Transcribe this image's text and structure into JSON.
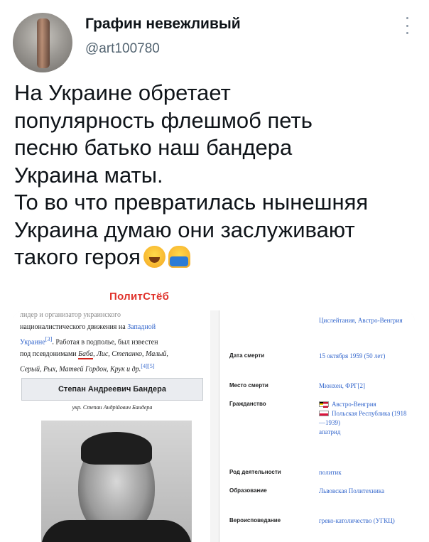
{
  "header": {
    "display_name": "Графин невежливый",
    "handle": "@art100780"
  },
  "tweet": {
    "lines": [
      "На Украине обретает",
      "популярность флешмоб петь",
      "песню батько наш бандера",
      "Украина маты.",
      "То во что превратилась нынешняя",
      "Украина думаю они заслуживают",
      "такого героя"
    ],
    "emojis": [
      "face-with-tears-of-joy",
      "person-facepalming"
    ]
  },
  "watermark": "ПолитСтёб",
  "wiki_left": {
    "line1": "лидер и организатор украинского",
    "line2a": "националистического движения на ",
    "line2b": "Западной",
    "line3a": "Украине",
    "line3ref": "[3]",
    "line3b": ". Работая в подполье, был известен",
    "line4a": "под псевдонимами ",
    "line4b": "Баба",
    "line4c": ", Лис, Степанко, Малый,",
    "line5a": "Серый, Рых, Матвей ",
    "line5b": "Гордон",
    "line5c": ", Крук и др.",
    "line5ref": "[4][5]",
    "infobox_title": "Степан Андреевич Бандера",
    "infobox_native": "укр. Степан Андрійович Бандера"
  },
  "wiki_right": {
    "top_value": "Цислейтания, Австро-Венгрия",
    "rows": [
      {
        "key": "Дата смерти",
        "value": "15 октября 1959 (50 лет)"
      },
      {
        "key": "Место смерти",
        "value": "Мюнхен, ФРГ[2]"
      },
      {
        "key": "Гражданство",
        "value1": "Австро-Венгрия",
        "value2": "Польская Республика (1918—1939)",
        "value3": "апатрид"
      },
      {
        "key": "Род деятельности",
        "value": "политик"
      },
      {
        "key": "Образование",
        "value": "Львовская Политехника"
      },
      {
        "key": "Вероисповедание",
        "value": "греко-католичество (УГКЦ)"
      }
    ]
  }
}
